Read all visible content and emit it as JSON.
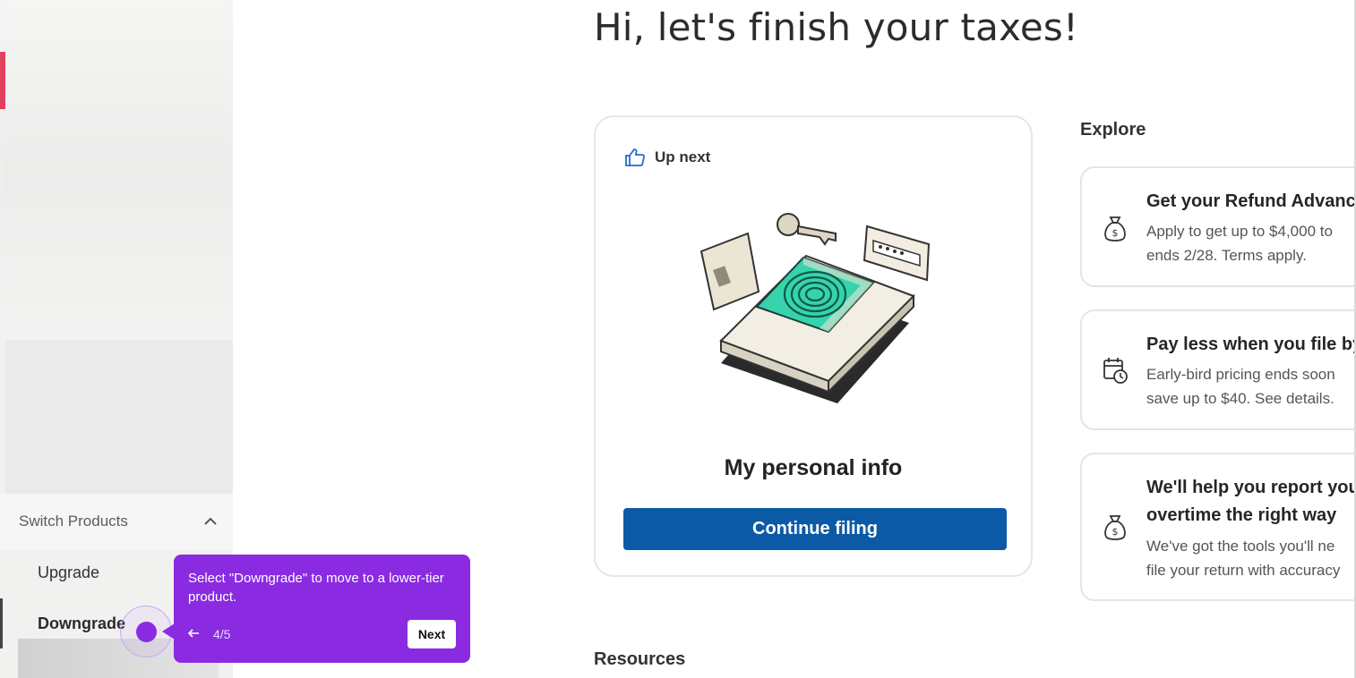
{
  "main": {
    "greeting": "Hi, let's finish your taxes!",
    "up_next_label": "Up next",
    "card_title": "My personal info",
    "continue_button": "Continue filing",
    "resources_title": "Resources"
  },
  "sidebar": {
    "switch_products_label": "Switch Products",
    "items": [
      {
        "label": "Upgrade"
      },
      {
        "label": "Downgrade"
      }
    ]
  },
  "explore": {
    "title": "Explore",
    "cards": [
      {
        "icon": "money-bag-icon",
        "title": "Get your Refund Advanc",
        "desc_line1": "Apply to get up to $4,000 to",
        "desc_line2": "ends 2/28. Terms apply."
      },
      {
        "icon": "calendar-clock-icon",
        "title": "Pay less when you file by",
        "desc_line1": "Early-bird pricing ends soon",
        "desc_line2": "save up to $40. See details."
      },
      {
        "icon": "money-bag-icon",
        "title_line1": "We'll help you report you",
        "title_line2": "overtime the right way",
        "desc_line1": "We've got the tools you'll ne",
        "desc_line2": "file your return with accuracy"
      }
    ]
  },
  "tour": {
    "message": "Select \"Downgrade\" to move to a lower-tier product.",
    "step": "4/5",
    "next_label": "Next",
    "color": "#8a2be2"
  },
  "colors": {
    "primary_button": "#0c5aa6",
    "sidebar_accent": "#e2405f"
  }
}
